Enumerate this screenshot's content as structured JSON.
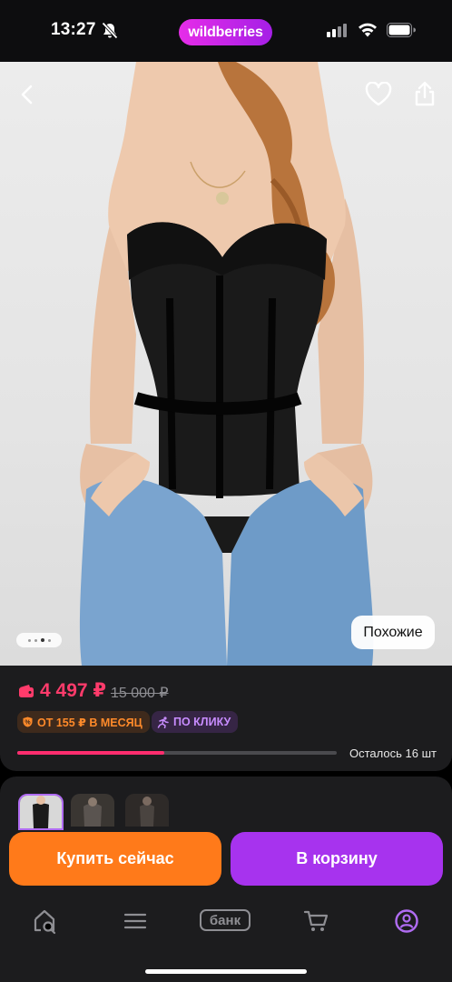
{
  "status": {
    "time": "13:27"
  },
  "brand": {
    "logo_text": "wildberries"
  },
  "product": {
    "similar_label": "Похожие",
    "price": "4 497 ₽",
    "old_price": "15 000 ₽",
    "installment": "ОТ 155 ₽ В МЕСЯЦ",
    "one_click": "ПО КЛИКУ",
    "remaining": "Осталось 16 шт",
    "stock_fraction": 0.46,
    "gallery_dot_count": 4,
    "active_dot": 2
  },
  "actions": {
    "buy_now": "Купить сейчас",
    "add_to_cart": "В корзину"
  },
  "nav": {
    "items": [
      {
        "name": "home-search-icon"
      },
      {
        "name": "catalog-menu-icon"
      },
      {
        "name": "bank",
        "label": "банк"
      },
      {
        "name": "cart-icon"
      },
      {
        "name": "profile-icon"
      }
    ]
  },
  "colors": {
    "price": "#ff3b6b",
    "buy": "#ff7a1a",
    "cart": "#a733ee",
    "brand": "#cb11ab"
  }
}
